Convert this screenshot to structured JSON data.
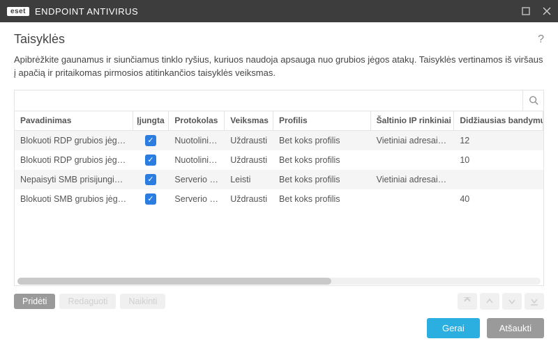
{
  "titlebar": {
    "brand_box": "eset",
    "brand_name": "ENDPOINT ANTIVIRUS"
  },
  "page": {
    "title": "Taisyklės",
    "description": "Apibrėžkite gaunamus ir siunčiamus tinklo ryšius, kuriuos naudoja apsauga nuo grubios jėgos atakų. Taisyklės vertinamos iš viršaus į apačią ir pritaikomas pirmosios atitinkančios taisyklės veiksmas."
  },
  "search": {
    "placeholder": ""
  },
  "columns": {
    "name": "Pavadinimas",
    "enabled": "Įjungta",
    "protocol": "Protokolas",
    "action": "Veiksmas",
    "profile": "Profilis",
    "srcip": "Šaltinio IP rinkiniai",
    "max": "Didžiausias bandymų skaičius"
  },
  "rows": [
    {
      "name": "Blokuoti RDP grubios jėgos ...",
      "enabled": true,
      "protocol": "Nuotolinio...",
      "action": "Uždrausti",
      "profile": "Bet koks profilis",
      "srcip": "Vietiniai adresai, ...",
      "max": "12"
    },
    {
      "name": "Blokuoti RDP grubios jėgos ...",
      "enabled": true,
      "protocol": "Nuotolinio...",
      "action": "Uždrausti",
      "profile": "Bet koks profilis",
      "srcip": "",
      "max": "10"
    },
    {
      "name": "Nepaisyti SMB prisijungimo ...",
      "enabled": true,
      "protocol": "Serverio pr...",
      "action": "Leisti",
      "profile": "Bet koks profilis",
      "srcip": "Vietiniai adresai, ...",
      "max": ""
    },
    {
      "name": "Blokuoti SMB grubios jėgos ...",
      "enabled": true,
      "protocol": "Serverio pr...",
      "action": "Uždrausti",
      "profile": "Bet koks profilis",
      "srcip": "",
      "max": "40"
    }
  ],
  "toolbar": {
    "add": "Pridėti",
    "edit": "Redaguoti",
    "delete": "Naikinti"
  },
  "footer": {
    "ok": "Gerai",
    "cancel": "Atšaukti"
  }
}
